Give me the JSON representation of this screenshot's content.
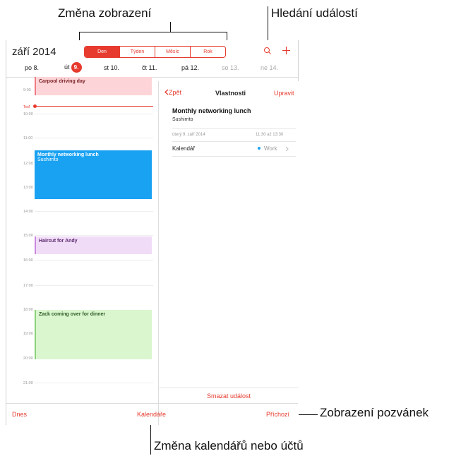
{
  "callouts": {
    "change_view": "Změna zobrazení",
    "search_events": "Hledání událostí",
    "invitations": "Zobrazení pozvánek",
    "calendars": "Změna kalendářů nebo účtů"
  },
  "header": {
    "month": "září 2014",
    "segments": [
      "Den",
      "Týden",
      "Měsíc",
      "Rok"
    ],
    "search_icon": "search-icon",
    "add_icon": "plus-icon"
  },
  "days": [
    {
      "label": "po 8."
    },
    {
      "label": "út",
      "badge": "9."
    },
    {
      "label": "st 10."
    },
    {
      "label": "čt 11."
    },
    {
      "label": "pá 12."
    },
    {
      "label": "so 13."
    },
    {
      "label": "ne 14."
    }
  ],
  "hours": [
    "9:00",
    "Teď",
    "10:00",
    "11:00",
    "12:00",
    "13:00",
    "14:00",
    "15:00",
    "16:00",
    "17:00",
    "18:00",
    "19:00",
    "20:00",
    "21:00"
  ],
  "events": [
    {
      "title": "Carpool driving day",
      "subtitle": ""
    },
    {
      "title": "Monthly networking lunch",
      "subtitle": "Sushirrito"
    },
    {
      "title": "Haircut for Andy",
      "subtitle": ""
    },
    {
      "title": "Zack coming over for dinner",
      "subtitle": ""
    }
  ],
  "detail": {
    "back": "Zpět",
    "title": "Vlastnosti",
    "edit": "Upravit",
    "event_title": "Monthly networking lunch",
    "location": "Sushirrito",
    "date": "úterý 9. září 2014",
    "time": "11:30 až 13:30",
    "calendar_label": "Kalendář",
    "calendar_value": "Work",
    "delete": "Smazat událost"
  },
  "tabbar": {
    "today": "Dnes",
    "calendars": "Kalendáře",
    "inbox": "Příchozí"
  },
  "colors": {
    "accent": "#e63b2e",
    "carpool": "#fdd5d8",
    "lunch": "#1aa2f2",
    "haircut": "#f1dcf7",
    "dinner": "#d9f6cf"
  }
}
